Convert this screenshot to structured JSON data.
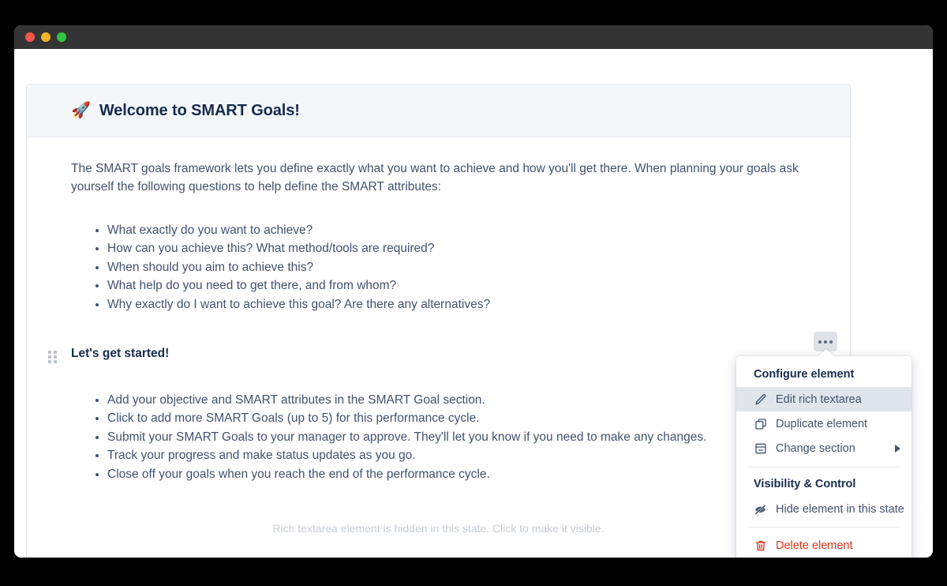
{
  "window": {
    "traffic_lights": [
      "close",
      "minimize",
      "maximize"
    ]
  },
  "card": {
    "icon": "rocket-emoji",
    "icon_glyph": "🚀",
    "title": "Welcome to SMART Goals!",
    "intro": "The SMART goals framework lets you define exactly what you want to achieve and how you'll get there. When planning your goals ask yourself the following questions to help define the SMART attributes:",
    "questions": [
      "What exactly do you want to achieve?",
      "How can you achieve this? What method/tools are required?",
      "When should you aim to achieve this?",
      "What help do you need to get there, and from whom?",
      "Why exactly do I want to achieve this goal? Are there any alternatives?"
    ],
    "subhead": "Let's get started!",
    "steps": [
      "Add your objective and SMART attributes in the SMART Goal section.",
      "Click to add more SMART Goals (up to 5) for this performance cycle.",
      "Submit your SMART Goals to your manager to approve. They'll let you know if you need to make any changes.",
      "Track your progress and make status updates as you go.",
      "Close off your goals when you reach the end of the performance cycle."
    ],
    "hidden_note": "Rich textarea element is hidden in this state. Click to make it visible."
  },
  "toolbar": {
    "drag_handle_label": "Drag to reorder",
    "more_options_label": "More options"
  },
  "menu": {
    "sections": [
      {
        "title": "Configure element",
        "items": [
          {
            "label": "Edit rich textarea",
            "icon": "pencil-icon",
            "active": true
          },
          {
            "label": "Duplicate element",
            "icon": "duplicate-icon",
            "active": false
          },
          {
            "label": "Change section",
            "icon": "section-icon",
            "active": false,
            "submenu": true
          }
        ]
      },
      {
        "title": "Visibility & Control",
        "items": [
          {
            "label": "Hide element in this state",
            "icon": "eye-off-icon",
            "active": false
          }
        ]
      },
      {
        "title": "",
        "items": [
          {
            "label": "Delete element",
            "icon": "trash-icon",
            "active": false,
            "danger": true
          }
        ]
      }
    ]
  },
  "colors": {
    "window_chrome": "#343434",
    "card_header_bg": "#f3f7fa",
    "card_border": "#e3e7ea",
    "text_primary": "#172b4d",
    "text_body": "#42526e",
    "menu_active_bg": "#dfe5ea",
    "danger": "#de3618",
    "muted": "#c8cdd4",
    "traffic_red": "#f2574d",
    "traffic_yellow": "#f5b32c",
    "traffic_green": "#33c43f"
  }
}
